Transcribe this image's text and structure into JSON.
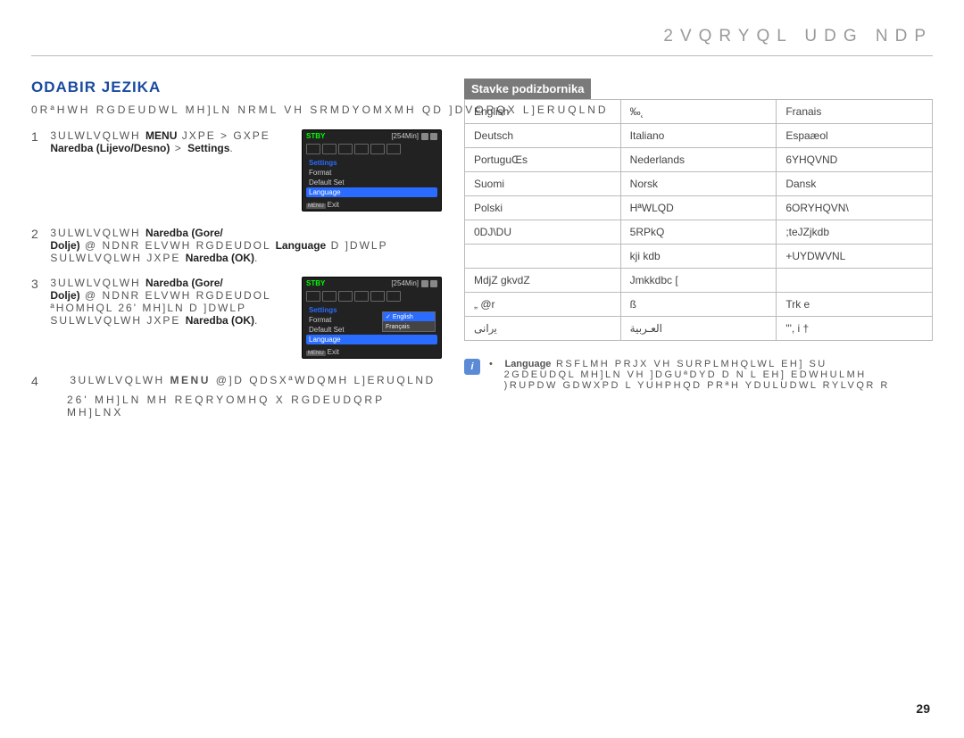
{
  "header_top": "2VQRYQL UDG NDP",
  "section_title": "ODABIR JEZIKA",
  "intro": "0RªHWH RGDEUDWL MH]LN NRML VH SRMDYOMXMH QD ]DVORQX L]ERUQLND",
  "steps": [
    {
      "num": "1",
      "txt": "3ULWLVQLWH MENU JXPE > GXPE Naredba (Lijevo/Desno) > Settings.",
      "screen": {
        "stby": "STBY",
        "time": "[254Min]",
        "hdr": "Settings",
        "items": [
          "Format",
          "Default Set",
          "Language"
        ],
        "sel_idx": 2,
        "exit_btn": "MENU",
        "exit_lbl": "Exit",
        "show_sub": false
      }
    },
    {
      "num": "2",
      "txt": "3ULWLVQLWH Naredba (Gore/Dolje) @ NDNR ELVWH RGDEUDOL Language D ]DWLP SULWLVQLWH JXPE Naredba (OK).",
      "screen": null
    },
    {
      "num": "3",
      "txt": "3ULWLVQLWH Naredba (Gore/Dolje) @ NDNR ELVWH RGDEUDOL ªHOMHQL 26' MH]LN D ]DWLP SULWLVQLWH JXPE Naredba (OK).",
      "screen": {
        "stby": "STBY",
        "time": "[254Min]",
        "hdr": "Settings",
        "items": [
          "Format",
          "Default Set",
          "Language"
        ],
        "sel_idx": 2,
        "exit_btn": "MENU",
        "exit_lbl": "Exit",
        "show_sub": true,
        "sub": [
          "English",
          "",
          "Français"
        ],
        "sub_sel": 0
      }
    }
  ],
  "step4": {
    "num": "4",
    "line1": "3ULWLVQLWH MENU @]D QDSXªWDQMH L]ERUQLND",
    "line2": "26' MH]LN MH REQRYOMHQ X RGDEUDQRP MH]LNX"
  },
  "subhead": "Stavke podizbornika",
  "langtable": [
    [
      "English",
      "‰˛",
      "Franais"
    ],
    [
      "Deutsch",
      "Italiano",
      "Espaæol"
    ],
    [
      "PortuguŒs",
      "Nederlands",
      "6YHQVND"
    ],
    [
      "Suomi",
      "Norsk",
      "Dansk"
    ],
    [
      "Polski",
      "HªWLQD",
      "6ORYHQVN\\"
    ],
    [
      "0DJ\\DU",
      "5RPkQ",
      ";teJZjkdb"
    ],
    [
      "",
      "kji kdb",
      "+UYDWVNL"
    ],
    [
      "MdjZ gkvdZ",
      "Jmkkdbc  [",
      ""
    ],
    [
      "„ @r",
      "ß",
      "Trk e"
    ],
    [
      "ﻳﺭﺍﻧﯽ",
      "ﺍﻟﻌـﺮﺑﻴﺔ",
      "\"', i †"
    ]
  ],
  "note": {
    "bullets": [
      "Language RSFLMH PRJX VH SURPLMHQLWL EH] SUHWKRGQH",
      "2GDEUDQL MH]LN VH ]DGUªDYD D N L EH] EDWHULMH",
      ")RUPDW GDWXPD L YUHPHQD PRªH YDULUDWL RYLVQR R"
    ]
  },
  "page": "29"
}
